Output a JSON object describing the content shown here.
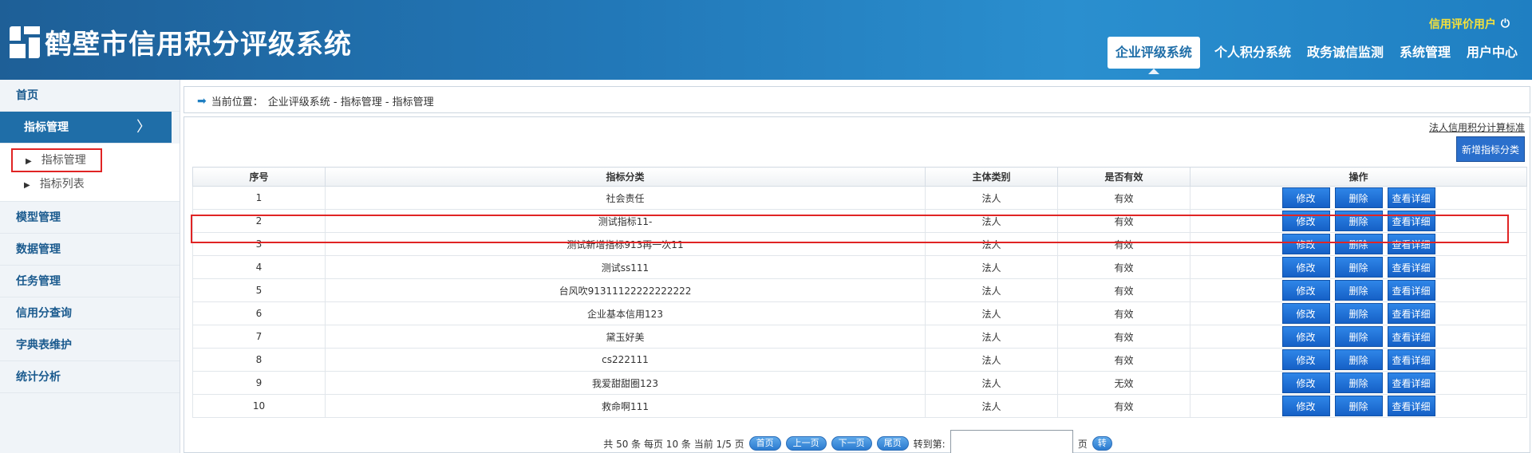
{
  "header": {
    "title": "鹤壁市信用积分评级系统",
    "user_label": "信用评价用户",
    "nav": [
      {
        "label": "企业评级系统",
        "active": true
      },
      {
        "label": "个人积分系统",
        "active": false
      },
      {
        "label": "政务诚信监测",
        "active": false
      },
      {
        "label": "系统管理",
        "active": false
      },
      {
        "label": "用户中心",
        "active": false
      }
    ]
  },
  "sidebar": {
    "home": "首页",
    "active_group": "指标管理",
    "sub_items": [
      "指标管理",
      "指标列表"
    ],
    "groups": [
      "模型管理",
      "数据管理",
      "任务管理",
      "信用分查询",
      "字典表维护",
      "统计分析"
    ]
  },
  "breadcrumb": {
    "prefix": "当前位置：",
    "path": "企业评级系统 - 指标管理 - 指标管理"
  },
  "toolbar": {
    "standard_link": "法人信用积分计算标准",
    "add_button": "新增指标分类"
  },
  "table": {
    "headers": [
      "序号",
      "指标分类",
      "主体类别",
      "是否有效",
      "操作"
    ],
    "action_labels": {
      "edit": "修改",
      "delete": "删除",
      "detail": "查看详细"
    },
    "rows": [
      {
        "no": "1",
        "category": "社会责任",
        "subject": "法人",
        "valid": "有效"
      },
      {
        "no": "2",
        "category": "测试指标11-",
        "subject": "法人",
        "valid": "有效"
      },
      {
        "no": "3",
        "category": "测试新增指标913再一次11",
        "subject": "法人",
        "valid": "有效"
      },
      {
        "no": "4",
        "category": "测试ss111",
        "subject": "法人",
        "valid": "有效"
      },
      {
        "no": "5",
        "category": "台风吹91311122222222222",
        "subject": "法人",
        "valid": "有效"
      },
      {
        "no": "6",
        "category": "企业基本信用123",
        "subject": "法人",
        "valid": "有效"
      },
      {
        "no": "7",
        "category": "黛玉好美",
        "subject": "法人",
        "valid": "有效"
      },
      {
        "no": "8",
        "category": "cs222111",
        "subject": "法人",
        "valid": "有效"
      },
      {
        "no": "9",
        "category": "我爱甜甜圈123",
        "subject": "法人",
        "valid": "无效"
      },
      {
        "no": "10",
        "category": "救命啊111",
        "subject": "法人",
        "valid": "有效"
      }
    ]
  },
  "pager": {
    "summary": "共 50 条 每页 10 条 当前 1/5 页",
    "first": "首页",
    "prev": "上一页",
    "next": "下一页",
    "last": "尾页",
    "goto_label": "转到第:",
    "page_unit": "页",
    "go": "转"
  }
}
